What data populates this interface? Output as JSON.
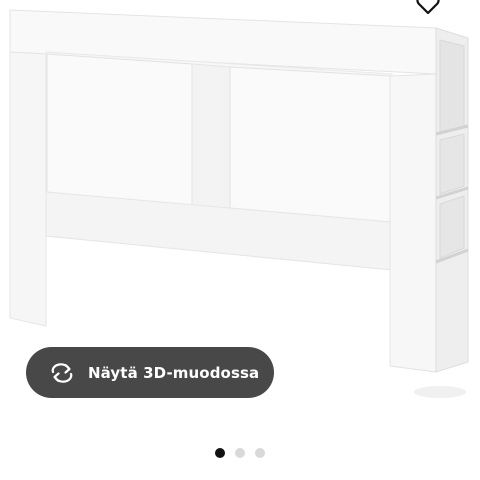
{
  "product": {
    "image_icon": "headboard-with-shelves-image"
  },
  "favourite": {
    "icon": "heart-outline-icon"
  },
  "view_3d": {
    "label": "Näytä 3D-muodossa",
    "icon": "rotate-arrows-icon",
    "background": "#484848"
  },
  "pager": {
    "total": 3,
    "active_index": 0,
    "active_color": "#111111",
    "inactive_color": "#d9d9d9"
  }
}
